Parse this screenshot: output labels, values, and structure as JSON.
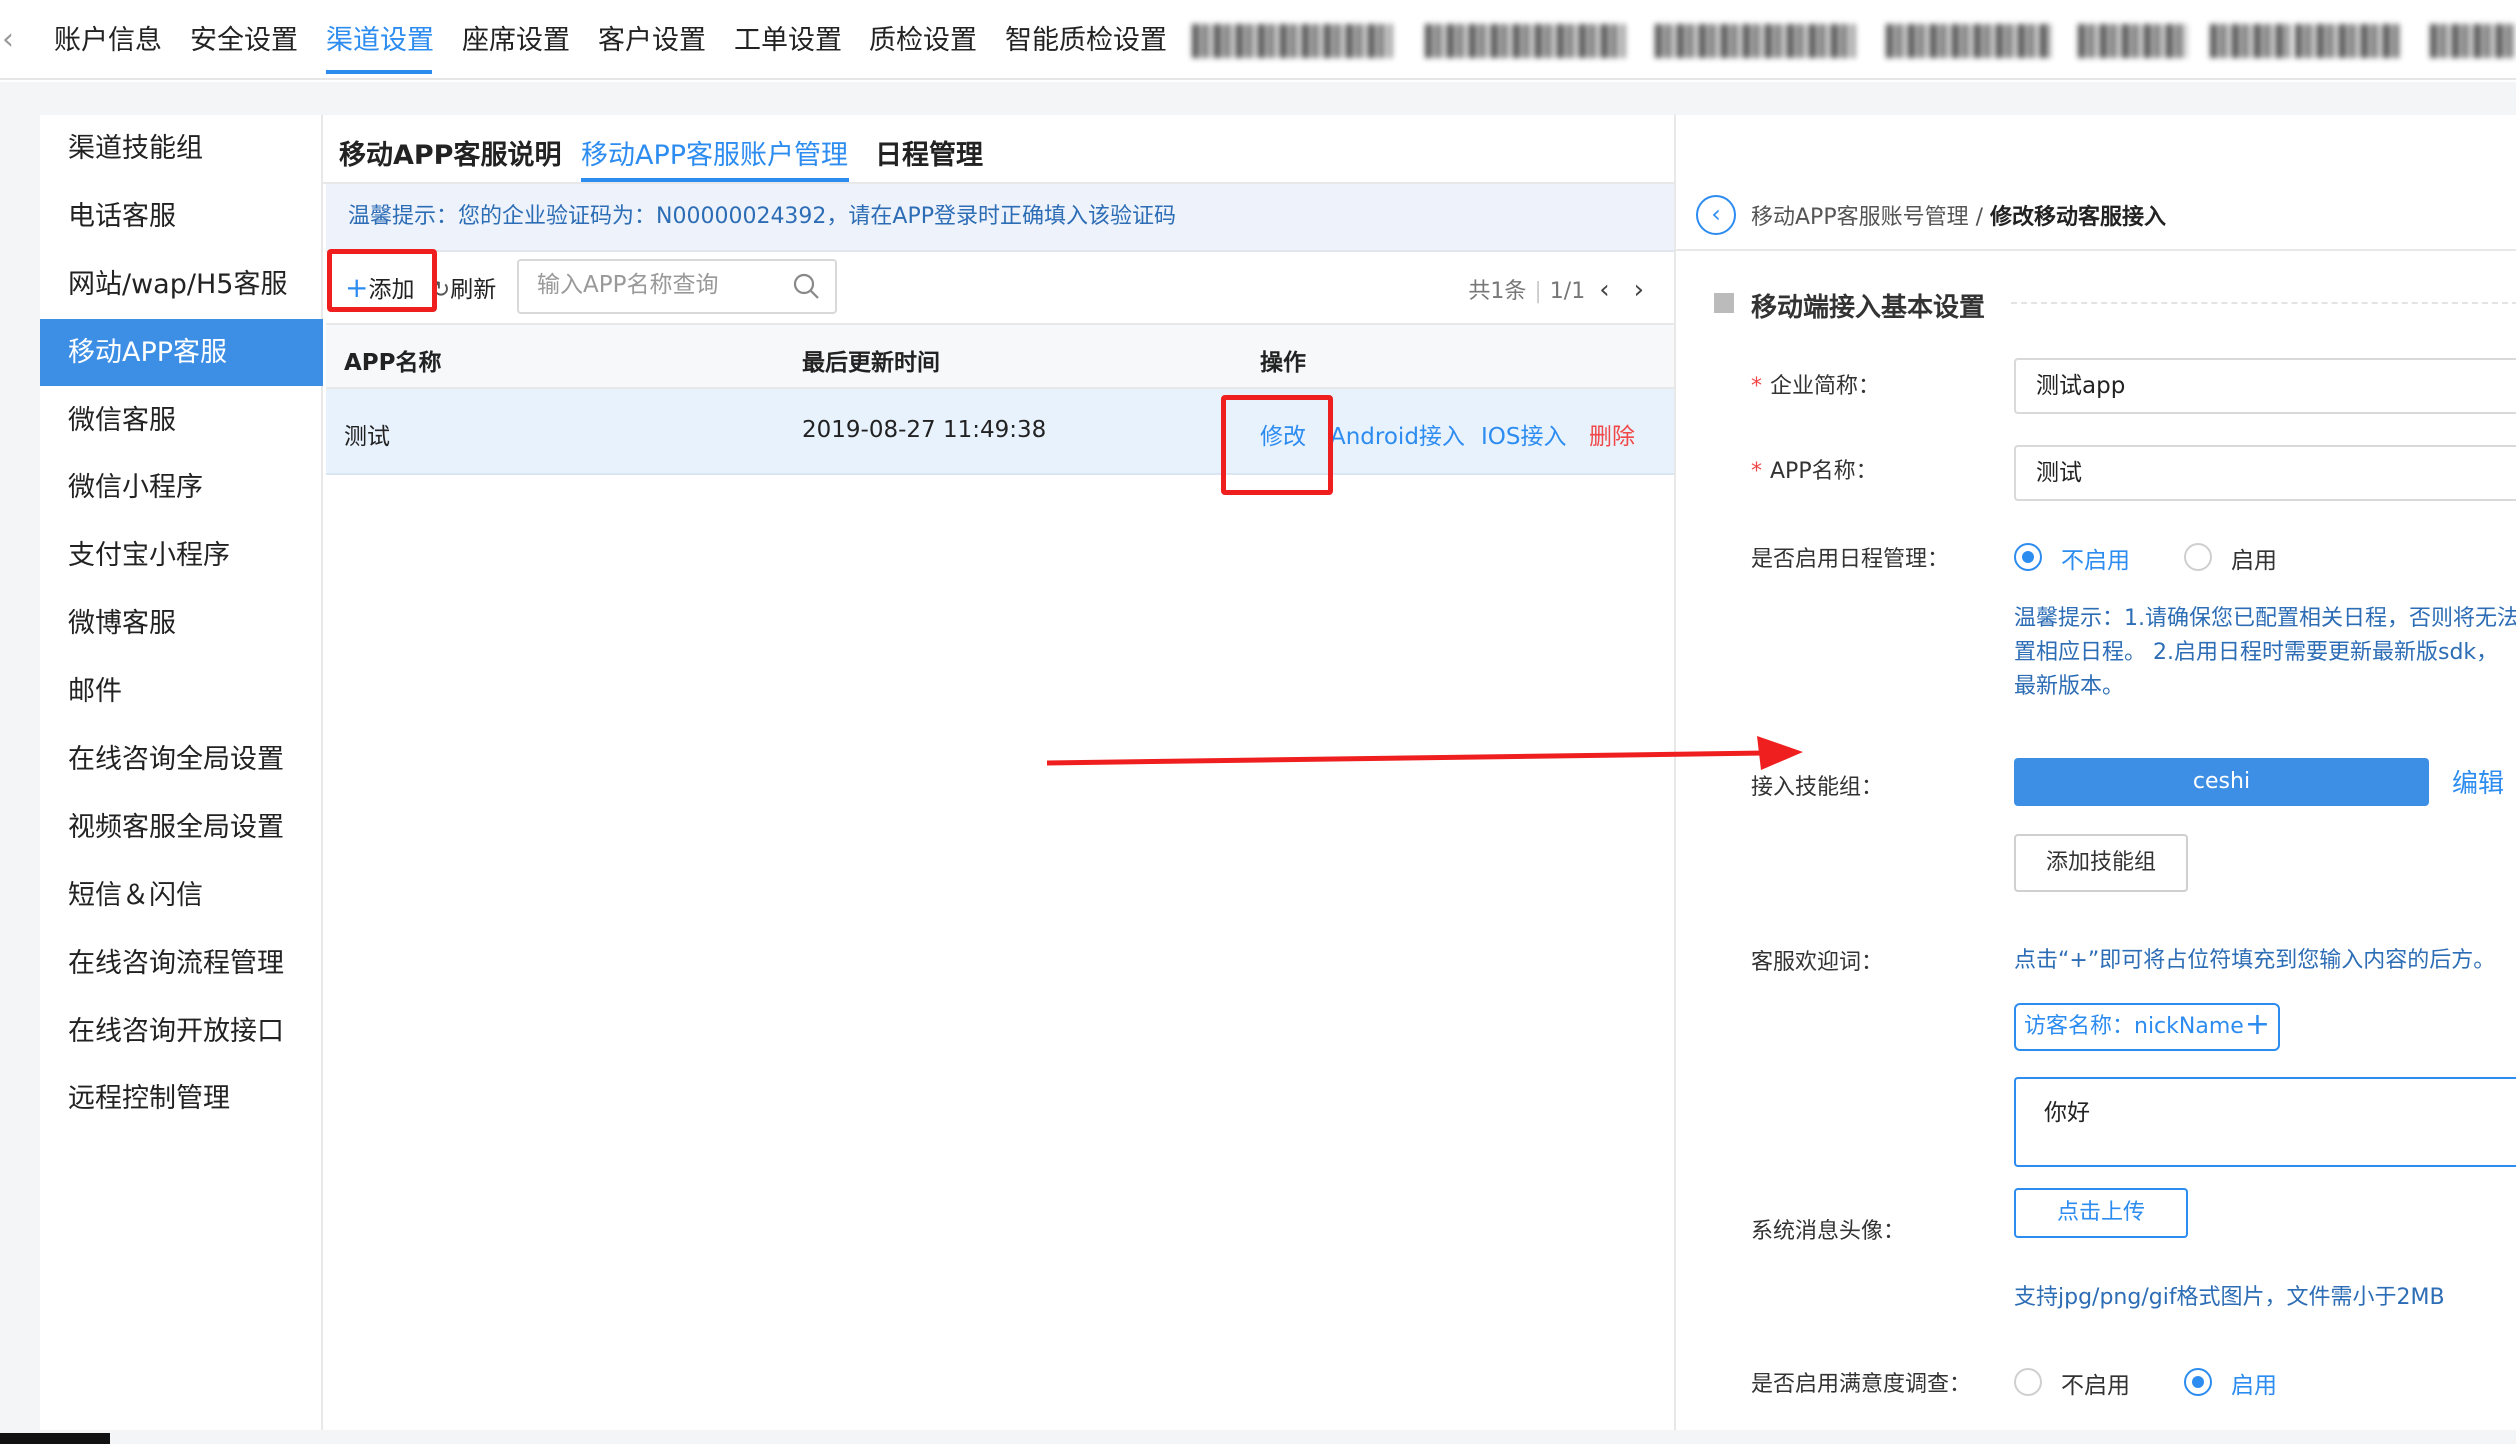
{
  "topnav": {
    "back_icon": "chevron-left-icon",
    "items": [
      "账户信息",
      "安全设置",
      "渠道设置",
      "座席设置",
      "客户设置",
      "工单设置",
      "质检设置",
      "智能质检设置"
    ],
    "active_index": 2
  },
  "sidebar": {
    "items": [
      "渠道技能组",
      "电话客服",
      "网站/wap/H5客服",
      "移动APP客服",
      "微信客服",
      "微信小程序",
      "支付宝小程序",
      "微博客服",
      "邮件",
      "在线咨询全局设置",
      "视频客服全局设置",
      "短信＆闪信",
      "在线咨询流程管理",
      "在线咨询开放接口",
      "远程控制管理"
    ],
    "active_index": 3
  },
  "tabs": [
    "移动APP客服说明",
    "移动APP客服账户管理",
    "日程管理"
  ],
  "tip": "温馨提示：您的企业验证码为：N00000024392，请在APP登录时正确填入该验证码",
  "toolbar": {
    "add_label": "添加",
    "refresh_label": "刷新",
    "search_placeholder": "输入APP名称查询",
    "pager_total": "共1条",
    "pager_page": "1/1"
  },
  "table": {
    "columns": [
      "APP名称",
      "最后更新时间",
      "操作"
    ],
    "rows": [
      {
        "name": "测试",
        "updated": "2019-08-27 11:49:38",
        "actions": [
          "修改",
          "Android接入",
          "IOS接入",
          "删除"
        ]
      }
    ]
  },
  "right_panel": {
    "breadcrumb_parent": "移动APP客服账号管理",
    "breadcrumb_sep": " / ",
    "breadcrumb_current": "修改移动客服接入",
    "section_title": "移动端接入基本设置",
    "fields": {
      "company_label": "企业简称：",
      "company_value": "测试app",
      "appname_label": "APP名称：",
      "appname_value": "测试",
      "schedule_label": "是否启用日程管理：",
      "schedule_options": [
        "不启用",
        "启用"
      ],
      "schedule_selected": "不启用",
      "schedule_hint_lines": [
        "温馨提示：1.请确保您已配置相关日程，否则将无法",
        "置相应日程。 2.启用日程时需要更新最新版sdk，",
        "最新版本。"
      ],
      "skill_label": "接入技能组：",
      "skill_tag": "ceshi",
      "skill_edit": "编辑",
      "add_skill_button": "添加技能组",
      "welcome_label": "客服欢迎词：",
      "welcome_hint": "点击“+”即可将占位符填充到您输入内容的后方。",
      "placeholder_tag": "访客名称：nickName",
      "welcome_value": "你好",
      "avatar_label": "系统消息头像：",
      "upload_button": "点击上传",
      "upload_hint": "支持jpg/png/gif格式图片，文件需小于2MB",
      "survey_label": "是否启用满意度调查：",
      "survey_options": [
        "不启用",
        "启用"
      ],
      "survey_selected": "启用"
    }
  },
  "colors": {
    "accent": "#2d8cf0",
    "sidebar_active": "#3d8fe6",
    "danger": "#f04848",
    "annotation_red": "#ef1f1f"
  }
}
